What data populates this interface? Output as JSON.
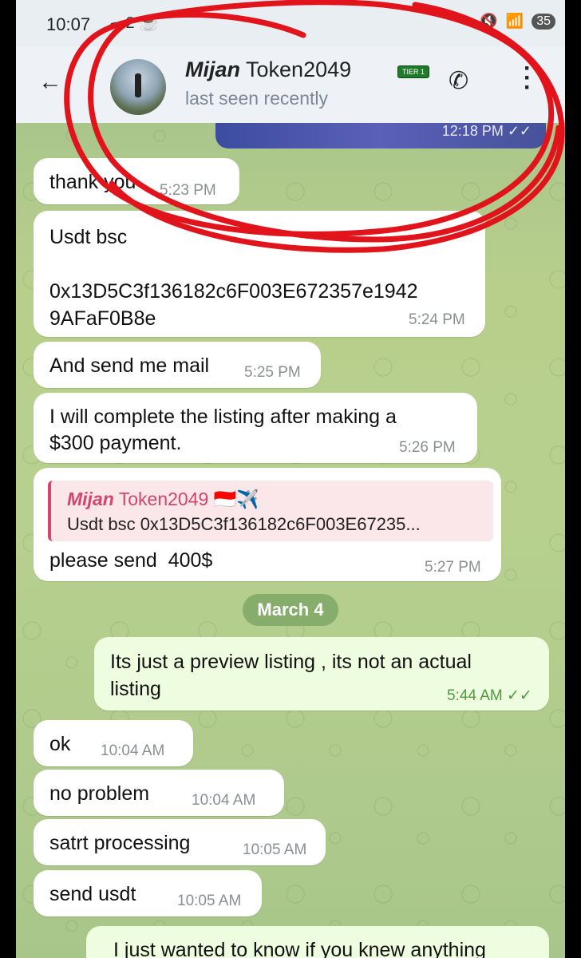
{
  "status_bar": {
    "time": "10:07",
    "icons": "☁ 2 ☕",
    "battery": "35"
  },
  "header": {
    "back_icon": "back-arrow-icon",
    "name_first": "Mijan",
    "name_rest": " Token2049",
    "badge": "TIER 1",
    "status": "last seen recently",
    "phone_icon": "phone-icon",
    "menu_icon": "more-vert-icon"
  },
  "image_message": {
    "time": "12:18 PM ✓✓"
  },
  "messages": [
    {
      "text": "thank you",
      "time": "5:23 PM"
    },
    {
      "text": "Usdt bsc\n\n0x13D5C3f136182c6F003E672357e1942\n9AFaF0B8e",
      "time": "5:24 PM"
    },
    {
      "text": "And send me mail",
      "time": "5:25 PM"
    },
    {
      "text": "I will complete the listing after making a\n$300 payment.",
      "time": "5:26 PM"
    },
    {
      "reply_name_first": "Mijan",
      "reply_name_rest": " Token2049 🇮🇩✈️",
      "reply_text": "Usdt bsc   0x13D5C3f136182c6F003E67235...",
      "text": "please send  400$",
      "time": "5:27 PM"
    },
    {
      "text": "ok",
      "time": "10:04 AM"
    },
    {
      "text": "no problem",
      "time": "10:04 AM"
    },
    {
      "text": "satrt processing",
      "time": "10:05 AM"
    },
    {
      "text": "send usdt",
      "time": "10:05 AM"
    }
  ],
  "date_separator": "March 4",
  "outgoing": [
    {
      "text": "Its just a preview listing , its not an actual\nlisting",
      "time": "5:44 AM ✓✓"
    },
    {
      "text": "I just wanted to know if you knew anything"
    }
  ],
  "colors": {
    "annotation": "#e0141a",
    "accent_green": "#4f9a3c"
  }
}
